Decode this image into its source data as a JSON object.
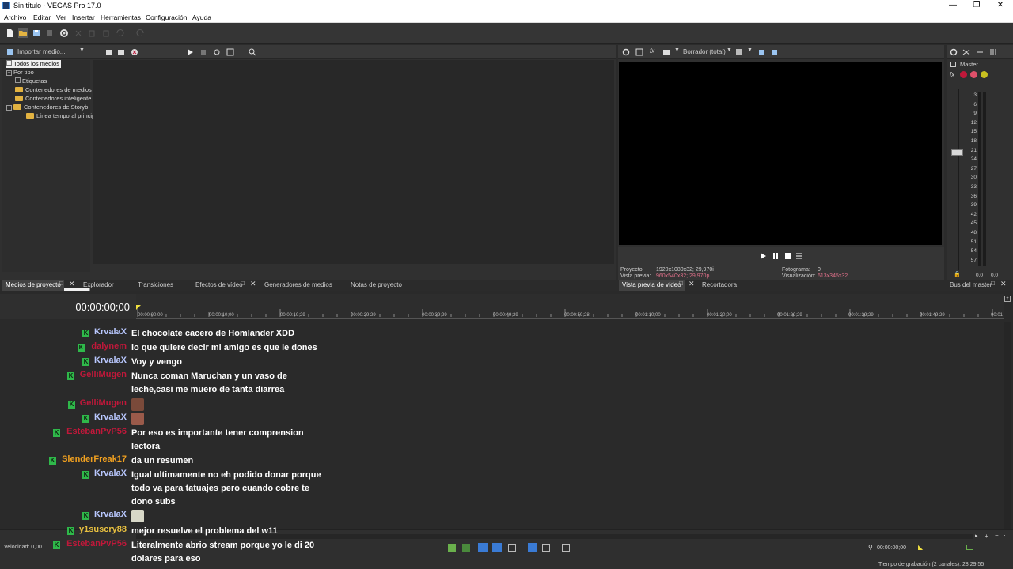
{
  "window": {
    "title": "Sin título - VEGAS Pro 17.0",
    "minimize": "—",
    "maximize": "❐",
    "close": "✕"
  },
  "menu": [
    "Archivo",
    "Editar",
    "Ver",
    "Insertar",
    "Herramientas",
    "Configuración",
    "Ayuda"
  ],
  "explorer": {
    "import_label": "Importar medio...",
    "tree": [
      {
        "label": "Todos los medios",
        "type": "item",
        "selected": true
      },
      {
        "label": "Por tipo",
        "type": "expand"
      },
      {
        "label": "Etiquetas",
        "type": "item"
      },
      {
        "label": "Contenedores de medios",
        "type": "folder"
      },
      {
        "label": "Contenedores inteligente",
        "type": "folder"
      },
      {
        "label": "Contenedores de Storyb",
        "type": "expand-folder"
      },
      {
        "label": "Línea temporal princip",
        "type": "subfolder"
      }
    ]
  },
  "left_tabs": [
    {
      "label": "Medios de proyecto",
      "active": true
    },
    {
      "label": "Explorador"
    },
    {
      "label": "Transiciones"
    },
    {
      "label": "Efectos de vídeo"
    },
    {
      "label": "Generadores de medios"
    },
    {
      "label": "Notas de proyecto"
    }
  ],
  "preview": {
    "mode_label": "Borrador (total)",
    "project_label": "Proyecto:",
    "project_value": "1920x1080x32; 29,970i",
    "preview_label": "Vista previa:",
    "preview_value": "960x540x32; 29,970p",
    "frame_label": "Fotograma:",
    "frame_value": "0",
    "display_label": "Visualización:",
    "display_value": "613x345x32",
    "tabs": [
      "Vista previa de vídeo",
      "Recortadora"
    ]
  },
  "master": {
    "title": "Master",
    "scale": [
      "3",
      "6",
      "9",
      "12",
      "15",
      "18",
      "21",
      "24",
      "27",
      "30",
      "33",
      "36",
      "39",
      "42",
      "45",
      "48",
      "51",
      "54",
      "57"
    ],
    "left_value": "0.0",
    "right_value": "0.0",
    "tab": "Bus del master"
  },
  "timeline": {
    "timecode": "00:00:00;00",
    "ruler": [
      "00:00:00;00",
      "00:00:10;00",
      "00:00:19;29",
      "00:00:29;29",
      "00:00:39;29",
      "00:00:49;29",
      "00:00:59;28",
      "00:01:10;00",
      "00:01:20;00",
      "00:01:29;29",
      "00:01:39;29",
      "00:01:49;29",
      "00:01"
    ],
    "rate_label": "Velocidad: 0,00",
    "end_timecode": "00:00:00;00",
    "record_time": "Tiempo de grabación (2 canales): 28:29:55"
  },
  "chat": [
    {
      "user": "KrvalaX",
      "color": "#b9c8ff",
      "msg": "El chocolate cacero de Homlander XDD"
    },
    {
      "user": "dalynem",
      "color": "#c0183a",
      "msg": "lo que quiere decir mi amigo es que le dones"
    },
    {
      "user": "KrvalaX",
      "color": "#b9c8ff",
      "msg": "Voy y vengo"
    },
    {
      "user": "GelliMugen",
      "color": "#c0183a",
      "msg": "Nunca coman Maruchan y un vaso de leche,casi me muero de tanta diarrea"
    },
    {
      "user": "GelliMugen",
      "color": "#c0183a",
      "msg": ""
    },
    {
      "user": "KrvalaX",
      "color": "#b9c8ff",
      "msg": ""
    },
    {
      "user": "EstebanPvP56",
      "color": "#c0183a",
      "msg": "Por eso es importante tener comprension lectora"
    },
    {
      "user": "SlenderFreak17",
      "color": "#f0a020",
      "msg": "da un resumen"
    },
    {
      "user": "KrvalaX",
      "color": "#b9c8ff",
      "msg": "Igual ultimamente no eh podido donar porque todo va para tatuajes pero cuando cobre te dono subs"
    },
    {
      "user": "KrvalaX",
      "color": "#b9c8ff",
      "msg": ""
    },
    {
      "user": "y1suscry88",
      "color": "#e8c040",
      "msg": "mejor resuelve el problema del w11"
    },
    {
      "user": "EstebanPvP56",
      "color": "#c0183a",
      "msg": "Literalmente abrio stream porque yo le di 20 dolares para eso"
    }
  ],
  "colors": {
    "accent": "#e3b341",
    "badge": "#2fb84a",
    "selection_blue": "#3a7bd5"
  }
}
